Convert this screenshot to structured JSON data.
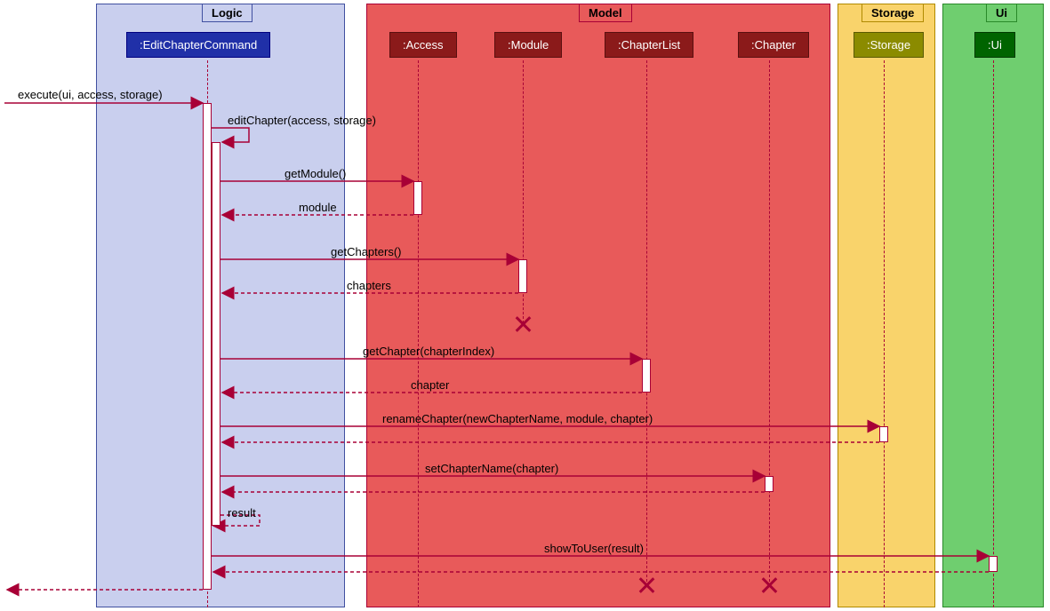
{
  "boxes": {
    "logic": {
      "header": "Logic",
      "bg": "#c9cfee",
      "border": "#4050a0",
      "headerText": "#000"
    },
    "model": {
      "header": "Model",
      "bg": "#e85a5a",
      "border": "#a80036",
      "headerText": "#000"
    },
    "storage": {
      "header": "Storage",
      "bg": "#f9d36b",
      "border": "#b08a00",
      "headerText": "#000"
    },
    "ui": {
      "header": "Ui",
      "bg": "#6fce6f",
      "border": "#2a8a2a",
      "headerText": "#000"
    }
  },
  "participants": {
    "editCmd": {
      "label": ":EditChapterCommand",
      "bg": "#2030a8",
      "border": "#000080"
    },
    "access": {
      "label": ":Access",
      "bg": "#8b1a1a",
      "border": "#5a0f0f"
    },
    "module": {
      "label": ":Module",
      "bg": "#8b1a1a",
      "border": "#5a0f0f"
    },
    "chapterList": {
      "label": ":ChapterList",
      "bg": "#8b1a1a",
      "border": "#5a0f0f"
    },
    "chapter": {
      "label": ":Chapter",
      "bg": "#8b1a1a",
      "border": "#5a0f0f"
    },
    "storage": {
      "label": ":Storage",
      "bg": "#8b8b00",
      "border": "#5a5a00"
    },
    "ui": {
      "label": ":Ui",
      "bg": "#006400",
      "border": "#003a00"
    }
  },
  "messages": {
    "m1": "execute(ui, access, storage)",
    "m2": "editChapter(access, storage)",
    "m3": "getModule()",
    "r3": "module",
    "m4": "getChapters()",
    "r4": "chapters",
    "m5": "getChapter(chapterIndex)",
    "r5": "chapter",
    "m6": "renameChapter(newChapterName, module, chapter)",
    "m7": "setChapterName(chapter)",
    "r8": "result",
    "m9": "showToUser(result)"
  },
  "chart_data": {
    "type": "sequence-diagram",
    "boxes": [
      {
        "name": "Logic",
        "participants": [
          "EditChapterCommand"
        ]
      },
      {
        "name": "Model",
        "participants": [
          "Access",
          "Module",
          "ChapterList",
          "Chapter"
        ]
      },
      {
        "name": "Storage",
        "participants": [
          "Storage"
        ]
      },
      {
        "name": "Ui",
        "participants": [
          "Ui"
        ]
      }
    ],
    "participants": [
      "EditChapterCommand",
      "Access",
      "Module",
      "ChapterList",
      "Chapter",
      "Storage",
      "Ui"
    ],
    "interactions": [
      {
        "from": "caller",
        "to": "EditChapterCommand",
        "label": "execute(ui, access, storage)",
        "type": "sync"
      },
      {
        "from": "EditChapterCommand",
        "to": "EditChapterCommand",
        "label": "editChapter(access, storage)",
        "type": "self"
      },
      {
        "from": "EditChapterCommand",
        "to": "Access",
        "label": "getModule()",
        "type": "sync"
      },
      {
        "from": "Access",
        "to": "EditChapterCommand",
        "label": "module",
        "type": "return"
      },
      {
        "from": "EditChapterCommand",
        "to": "Module",
        "label": "getChapters()",
        "type": "sync"
      },
      {
        "from": "Module",
        "to": "EditChapterCommand",
        "label": "chapters",
        "type": "return",
        "destroy": "Module"
      },
      {
        "from": "EditChapterCommand",
        "to": "ChapterList",
        "label": "getChapter(chapterIndex)",
        "type": "sync"
      },
      {
        "from": "ChapterList",
        "to": "EditChapterCommand",
        "label": "chapter",
        "type": "return"
      },
      {
        "from": "EditChapterCommand",
        "to": "Storage",
        "label": "renameChapter(newChapterName, module, chapter)",
        "type": "sync"
      },
      {
        "from": "Storage",
        "to": "EditChapterCommand",
        "label": "",
        "type": "return"
      },
      {
        "from": "EditChapterCommand",
        "to": "Chapter",
        "label": "setChapterName(chapter)",
        "type": "sync"
      },
      {
        "from": "Chapter",
        "to": "EditChapterCommand",
        "label": "",
        "type": "return"
      },
      {
        "from": "EditChapterCommand",
        "to": "EditChapterCommand",
        "label": "result",
        "type": "self-return"
      },
      {
        "from": "EditChapterCommand",
        "to": "Ui",
        "label": "showToUser(result)",
        "type": "sync"
      },
      {
        "from": "Ui",
        "to": "EditChapterCommand",
        "label": "",
        "type": "return",
        "destroy": [
          "ChapterList",
          "Chapter"
        ]
      },
      {
        "from": "EditChapterCommand",
        "to": "caller",
        "label": "",
        "type": "return"
      }
    ]
  }
}
